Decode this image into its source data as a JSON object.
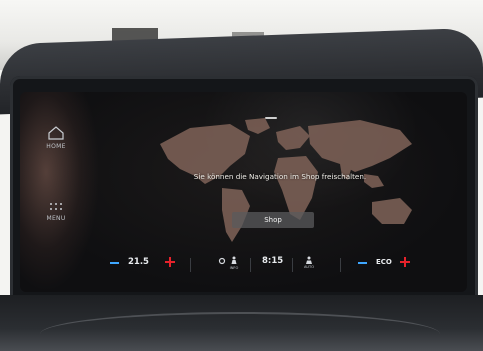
{
  "home": {
    "label": "HOME",
    "icon": "home-icon"
  },
  "menu": {
    "label": "MENU",
    "icon": "grid-dots-icon"
  },
  "navigation": {
    "message": "Sie können die Navigation im Shop freischalten.",
    "shop_button": "Shop"
  },
  "climate": {
    "temperature_left": "21.5",
    "time": "8:15",
    "info_label": "INFO",
    "auto_label": "AUTO",
    "right_label": "ECO"
  },
  "colors": {
    "minus": "#3fa7ff",
    "plus": "#e7222b",
    "continents": "#7a5f55"
  }
}
